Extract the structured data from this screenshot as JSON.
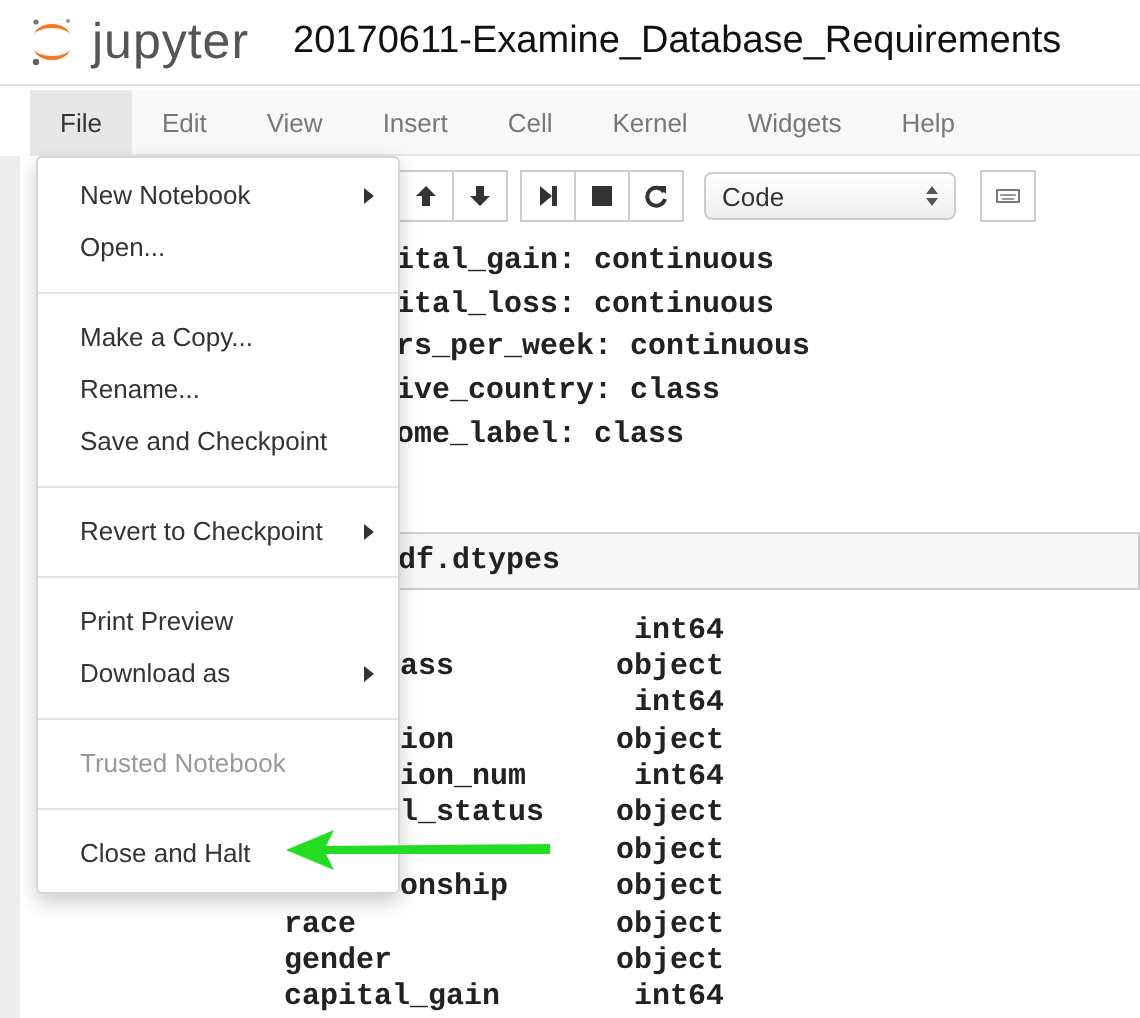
{
  "header": {
    "brand": "jupyter",
    "title": "20170611-Examine_Database_Requirements"
  },
  "menubar": [
    {
      "label": "File",
      "selected": true
    },
    {
      "label": "Edit",
      "selected": false
    },
    {
      "label": "View",
      "selected": false
    },
    {
      "label": "Insert",
      "selected": false
    },
    {
      "label": "Cell",
      "selected": false
    },
    {
      "label": "Kernel",
      "selected": false
    },
    {
      "label": "Widgets",
      "selected": false
    },
    {
      "label": "Help",
      "selected": false
    }
  ],
  "toolbar": {
    "cell_type": "Code"
  },
  "file_menu": {
    "groups": [
      [
        {
          "label": "New Notebook",
          "submenu": true,
          "disabled": false
        },
        {
          "label": "Open...",
          "submenu": false,
          "disabled": false
        }
      ],
      [
        {
          "label": "Make a Copy...",
          "submenu": false,
          "disabled": false
        },
        {
          "label": "Rename...",
          "submenu": false,
          "disabled": false
        },
        {
          "label": "Save and Checkpoint",
          "submenu": false,
          "disabled": false
        }
      ],
      [
        {
          "label": "Revert to Checkpoint",
          "submenu": true,
          "disabled": false
        }
      ],
      [
        {
          "label": "Print Preview",
          "submenu": false,
          "disabled": false
        },
        {
          "label": "Download as",
          "submenu": true,
          "disabled": false
        }
      ],
      [
        {
          "label": "Trusted Notebook",
          "submenu": false,
          "disabled": true
        }
      ],
      [
        {
          "label": "Close and Halt",
          "submenu": false,
          "disabled": false
        }
      ]
    ]
  },
  "cells": [
    {
      "kind": "output",
      "lines": [
        "ital_gain: continuous",
        "ital_loss: continuous",
        "rs_per_week: continuous",
        "ive_country: class",
        "ome_label: class"
      ]
    },
    {
      "kind": "input",
      "code": "df.dtypes"
    },
    {
      "kind": "table",
      "rows": [
        {
          "type": "int64"
        },
        {
          "name": "ass",
          "type": "object",
          "clipped": true
        },
        {
          "type": "int64"
        },
        {
          "name": "ion",
          "type": "object",
          "clipped": true
        },
        {
          "name": "ion_num",
          "type": "int64",
          "clipped": true
        },
        {
          "name": "l_status",
          "type": "object",
          "clipped": true
        },
        {
          "type": "object"
        },
        {
          "name": "onship",
          "type": "object",
          "clipped": true
        },
        {
          "name": "race",
          "type": "object",
          "clipped": false
        },
        {
          "name": "gender",
          "type": "object",
          "clipped": false
        },
        {
          "name": "capital_gain",
          "type": "int64",
          "clipped": false
        }
      ]
    }
  ]
}
